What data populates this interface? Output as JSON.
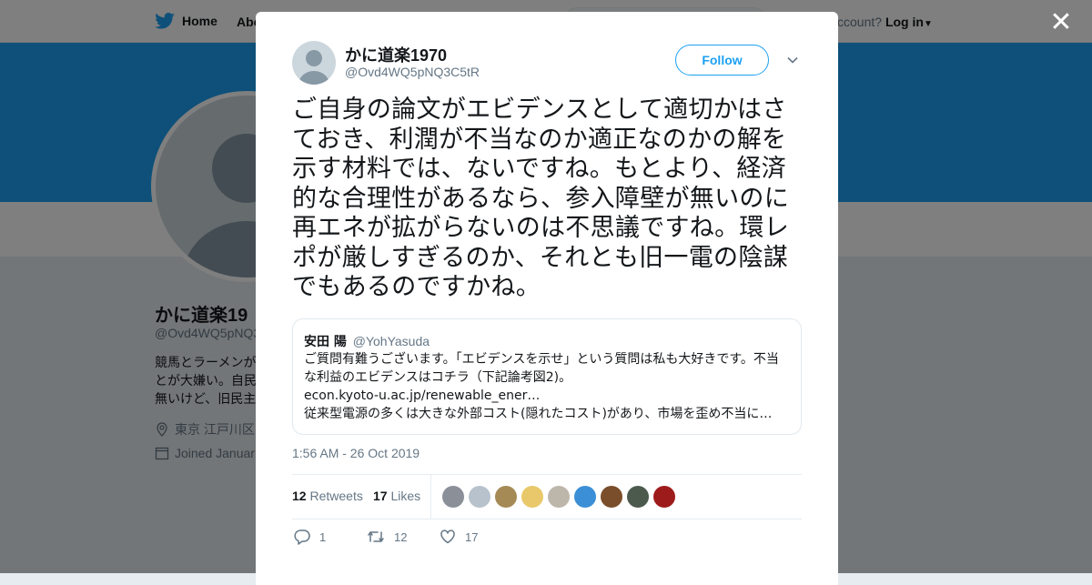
{
  "nav": {
    "home": "Home",
    "about": "Abo",
    "account_prompt": "ccount?",
    "login": "Log in"
  },
  "profile": {
    "name": "かに道楽19",
    "handle": "@Ovd4WQ5pNQ3",
    "bio": [
      "競馬とラーメンが",
      "とが大嫌い。自民",
      "無いけど、旧民主"
    ],
    "location": "東京 江戸川区",
    "joined": "Joined Januar"
  },
  "tweet": {
    "author_name": "かに道楽1970",
    "author_handle": "@Ovd4WQ5pNQ3C5tR",
    "follow_label": "Follow",
    "text": "ご自身の論文がエビデンスとして適切かはさておき、利潤が不当なのか適正なのかの解を示す材料では、ないですね。もとより、経済的な合理性があるなら、参入障壁が無いのに再エネが拡がらないのは不思議ですね。環レポが厳しすぎるのか、それとも旧一電の陰謀でもあるのですかね。",
    "timestamp": "1:56 AM - 26 Oct 2019",
    "quote": {
      "name": "安田 陽",
      "handle": "@YohYasuda",
      "line1": "ご質問有難うございます。「エビデンスを示せ」という質問は私も大好きです。不当",
      "line2": "な利益のエビデンスはコチラ（下記論考図2)。",
      "line3": "econ.kyoto-u.ac.jp/renewable_ener…",
      "line4": "従来型電源の多くは大きな外部コスト(隠れたコスト)があり、市場を歪め不当に…"
    },
    "stats": {
      "retweets_count": "12",
      "retweets_label": "Retweets",
      "likes_count": "17",
      "likes_label": "Likes"
    },
    "likers": [
      {
        "icon": "liker-avatar-1",
        "color": "#8a8f98"
      },
      {
        "icon": "liker-avatar-2",
        "color": "#b8c2cc"
      },
      {
        "icon": "liker-avatar-3",
        "color": "#a58a56"
      },
      {
        "icon": "liker-avatar-4",
        "color": "#e8c86a"
      },
      {
        "icon": "liker-avatar-5",
        "color": "#bdb6ab"
      },
      {
        "icon": "liker-avatar-6",
        "color": "#3b8fd6"
      },
      {
        "icon": "liker-avatar-7",
        "color": "#7a4e2a"
      },
      {
        "icon": "liker-avatar-8",
        "color": "#4c5a4e"
      },
      {
        "icon": "liker-avatar-9",
        "color": "#9e1b1b"
      }
    ],
    "actions": {
      "replies": "1",
      "retweets": "12",
      "likes": "17"
    }
  },
  "colors": {
    "brand_blue": "#1da1f2",
    "text_dark": "#14171a",
    "text_gray": "#657786"
  }
}
